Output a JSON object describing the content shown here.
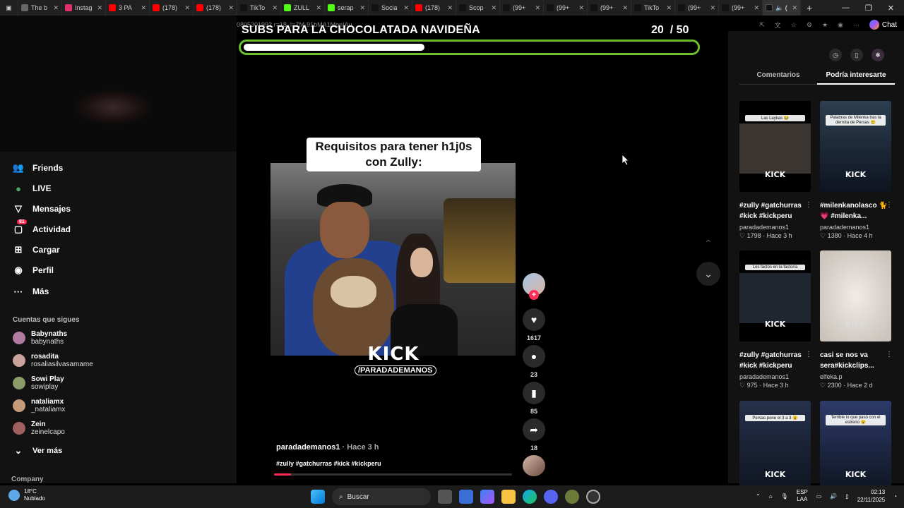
{
  "browser": {
    "tabs": [
      {
        "title": "The b",
        "color": "#666"
      },
      {
        "title": "Instag",
        "color": "#e1306c"
      },
      {
        "title": "3 PA",
        "color": "#ff0000"
      },
      {
        "title": "(178)",
        "color": "#ff0000"
      },
      {
        "title": "(178)",
        "color": "#ff0000"
      },
      {
        "title": "TikTo",
        "color": "#111"
      },
      {
        "title": "ZULL",
        "color": "#53fc18"
      },
      {
        "title": "serap",
        "color": "#53fc18"
      },
      {
        "title": "Socia",
        "color": "#111"
      },
      {
        "title": "(178)",
        "color": "#ff0000"
      },
      {
        "title": "Scop",
        "color": "#111"
      },
      {
        "title": "(99+",
        "color": "#111"
      },
      {
        "title": "(99+",
        "color": "#111"
      },
      {
        "title": "(99+",
        "color": "#111"
      },
      {
        "title": "TikTo",
        "color": "#111"
      },
      {
        "title": "(99+",
        "color": "#111"
      },
      {
        "title": "(99+",
        "color": "#111"
      }
    ],
    "url_partial": "0805301992 r=18_l=ZM-91bMA1Mon|Au",
    "chat_label": "Chat",
    "window_controls": [
      "—",
      "❐",
      "✕"
    ]
  },
  "stream_overlay": {
    "title": "SUBS PARA LA CHOCOLATADA NAVIDEÑA",
    "count_current": "20",
    "count_total": "/ 50",
    "progress_fraction": 0.4,
    "bar_color": "#6abf2d"
  },
  "sidebar": {
    "nav": [
      {
        "label": "Friends",
        "icon": "friends-icon",
        "glyph": "👥"
      },
      {
        "label": "LIVE",
        "icon": "live-icon",
        "glyph": "●"
      },
      {
        "label": "Mensajes",
        "icon": "messages-icon",
        "glyph": "▽"
      },
      {
        "label": "Actividad",
        "icon": "activity-icon",
        "glyph": "▢",
        "badge": "81"
      },
      {
        "label": "Cargar",
        "icon": "upload-icon",
        "glyph": "⊞"
      },
      {
        "label": "Perfil",
        "icon": "profile-icon",
        "glyph": "◉"
      },
      {
        "label": "Más",
        "icon": "more-icon",
        "glyph": "···"
      }
    ],
    "following_title": "Cuentas que sigues",
    "following": [
      {
        "name": "Babynaths",
        "handle": "babynaths",
        "color": "#b07aa1"
      },
      {
        "name": "rosadita",
        "handle": "rosaliasilvasamame",
        "color": "#c9a29b"
      },
      {
        "name": "Sowi Play",
        "handle": "sowiplay",
        "color": "#8b9c6a"
      },
      {
        "name": "nataliamx",
        "handle": "_nataliamx",
        "color": "#c49a7a"
      },
      {
        "name": "Zein",
        "handle": "zeinelcapo",
        "color": "#a06060"
      }
    ],
    "see_more": "Ver más",
    "company": "Company"
  },
  "video": {
    "caption_line1": "Requisitos para tener h1j0s",
    "caption_line2": "con Zully:",
    "watermark_big": "KICK",
    "watermark_small": "/PARADADEMANOS",
    "author": "paradademanos1",
    "time": "· Hace 3 h",
    "tags": "#zully #gatchurras #kick #kickperu",
    "progress_fraction": 0.07
  },
  "actions": {
    "likes": "1617",
    "comments": "23",
    "saves": "85",
    "shares": "18"
  },
  "right_panel": {
    "tabs": [
      "Comentarios",
      "Podría interesarte"
    ],
    "active_tab": 1,
    "cards": [
      {
        "title": "#zully #gatchurras #kick #kickperu",
        "author": "paradademanos1",
        "likes": "1798",
        "time": "Hace 3 h",
        "thumb_label": "Las Laykas 😂",
        "thumb_color": "#3a3530"
      },
      {
        "title": "#milenkanolasco 🐈💗 #milenka...",
        "author": "paradademanos1",
        "likes": "1380",
        "time": "Hace 4 h",
        "thumb_label": "Palabras de Milenka tras la derrota de Persas 😢",
        "thumb_color": "#2c3e50"
      },
      {
        "title": "#zully #gatchurras #kick #kickperu",
        "author": "paradademanos1",
        "likes": "975",
        "time": "Hace 3 h",
        "thumb_label": "Los factos en la factoría",
        "thumb_color": "#1f2630"
      },
      {
        "title": "casi se nos va sera#kickclips...",
        "author": "elfeka.p",
        "likes": "2300",
        "time": "Hace 2 d",
        "thumb_label": "",
        "thumb_color": "#d8d2cc"
      },
      {
        "title": "",
        "author": "",
        "likes": "",
        "time": "",
        "thumb_label": "Persas pone el 3 a 3 😮",
        "thumb_color": "#25304a"
      },
      {
        "title": "",
        "author": "",
        "likes": "",
        "time": "",
        "thumb_label": "Terrible lo que pasó con el estreno 😮",
        "thumb_color": "#2d3b6a"
      }
    ]
  },
  "taskbar": {
    "temp": "18°C",
    "weather": "Nublado",
    "search_placeholder": "Buscar",
    "lang1": "ESP",
    "lang2": "LAA",
    "time": "02:13",
    "date": "22/11/2025"
  }
}
